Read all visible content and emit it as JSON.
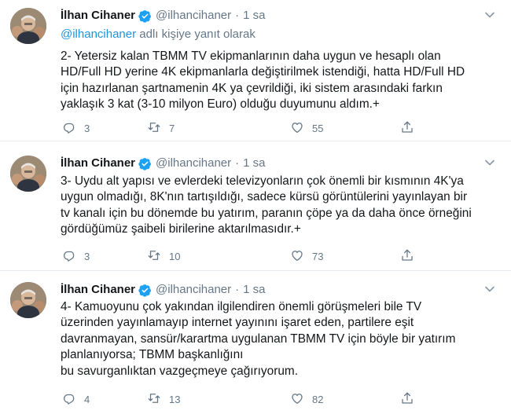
{
  "colors": {
    "accent": "#1da1f2",
    "muted": "#657786",
    "text": "#14171a",
    "divider": "#e6ecf0"
  },
  "tweets": [
    {
      "name": "İlhan Cihaner",
      "handle": "@ilhancihaner",
      "dot": "·",
      "time": "1 sa",
      "reply_prefix": "@ilhancihaner",
      "reply_suffix": " adlı kişiye yanıt olarak",
      "lines": [
        "2- Yetersiz kalan TBMM TV ekipmanlarının daha uygun ve hesaplı olan",
        "HD/Full HD yerine 4K ekipmanlarla değiştirilmek istendiği, hatta HD/Full HD",
        "için hazırlanan şartnamenin 4K ya çevrildiği, iki sistem arasındaki farkın",
        "yaklaşık 3 kat (3-10 milyon Euro) olduğu duyumunu aldım.+"
      ],
      "replies": "3",
      "retweets": "7",
      "likes": "55"
    },
    {
      "name": "İlhan Cihaner",
      "handle": "@ilhancihaner",
      "dot": "·",
      "time": "1 sa",
      "lines": [
        "3- Uydu alt yapısı ve evlerdeki televizyonların çok önemli bir kısmının 4K'ya",
        "uygun olmadığı, 8K'nın tartışıldığı, sadece kürsü görüntülerini yayınlayan bir",
        "tv kanalı için bu dönemde bu yatırım, paranın çöpe ya da daha önce örneğini",
        "gördüğümüz şaibeli birilerine  aktarılmasıdır.+"
      ],
      "replies": "3",
      "retweets": "10",
      "likes": "73"
    },
    {
      "name": "İlhan Cihaner",
      "handle": "@ilhancihaner",
      "dot": "·",
      "time": "1 sa",
      "lines": [
        "4- Kamuoyunu çok yakından ilgilendiren önemli görüşmeleri bile TV",
        "üzerinden yayınlamayıp internet yayınını işaret eden, partilere eşit",
        "davranmayan, sansür/karartma uygulanan TBMM TV için böyle bir yatırım",
        "planlanıyorsa; TBMM başkanlığını",
        "bu savurganlıktan vazgeçmeye çağırıyorum."
      ],
      "replies": "4",
      "retweets": "13",
      "likes": "82"
    }
  ],
  "icons": {
    "verified": "verified-badge-icon",
    "caret": "chevron-down-icon",
    "reply": "reply-icon",
    "retweet": "retweet-icon",
    "like": "heart-icon",
    "share": "share-icon"
  }
}
